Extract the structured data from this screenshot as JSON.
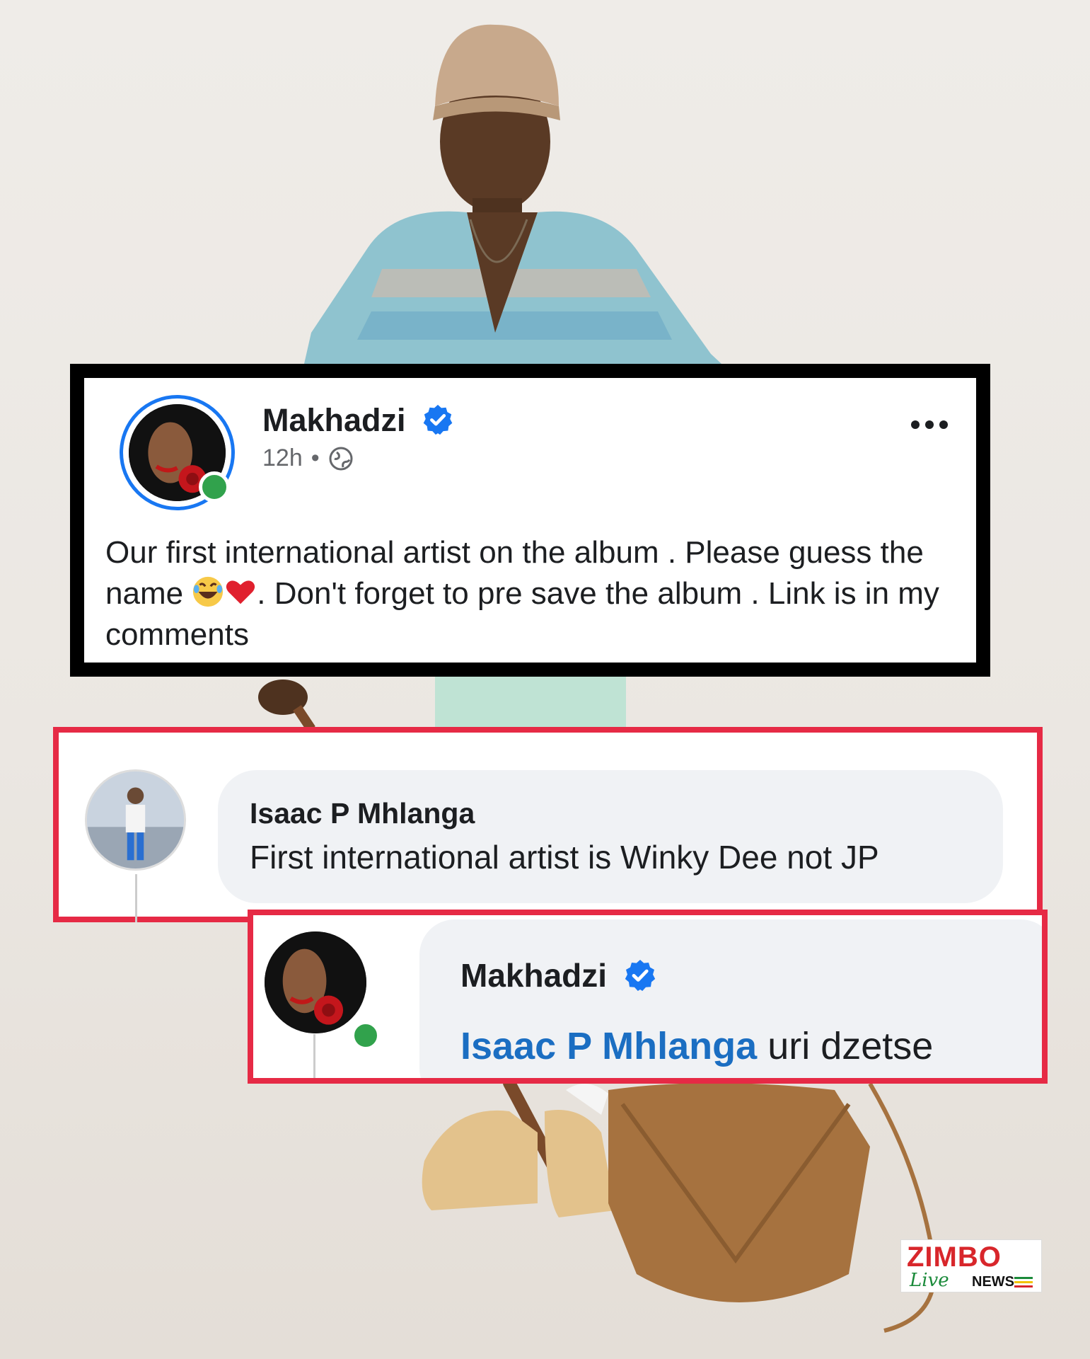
{
  "post": {
    "author": "Makhadzi",
    "time": "12h",
    "separator": "•",
    "text_part1": "Our first international artist on the album . Please guess the name ",
    "text_emojis": "😂❤️",
    "text_part2": ". Don't forget to pre save the album . Link is in my comments",
    "avatar": "profile-photo",
    "privacy_icon": "globe-icon",
    "more_icon": "more-options-icon",
    "verified_icon": "verified-badge-icon"
  },
  "comment": {
    "author": "Isaac P Mhlanga",
    "text": "First international artist is Winky Dee not JP"
  },
  "reply": {
    "author": "Makhadzi",
    "mention": "Isaac P Mhlanga",
    "text": " uri dzetse"
  },
  "logo": {
    "brand": "ZIMBO",
    "live": "Live",
    "news": "NEWS"
  },
  "colors": {
    "verified_blue": "#1877f2",
    "online_green": "#31a24c",
    "highlight_red": "#e62a45",
    "mention_blue": "#1b6ec2"
  }
}
